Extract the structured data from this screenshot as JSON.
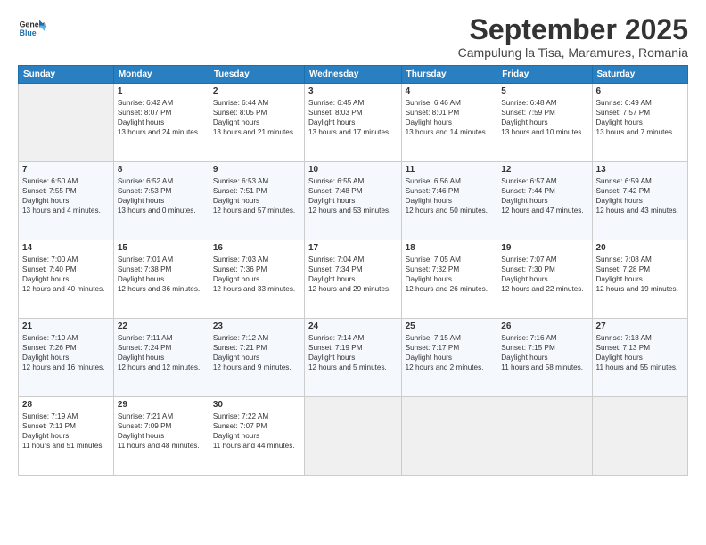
{
  "header": {
    "logo_top": "General",
    "logo_bottom": "Blue",
    "month": "September 2025",
    "location": "Campulung la Tisa, Maramures, Romania"
  },
  "days_of_week": [
    "Sunday",
    "Monday",
    "Tuesday",
    "Wednesday",
    "Thursday",
    "Friday",
    "Saturday"
  ],
  "weeks": [
    [
      {
        "day": null
      },
      {
        "day": 1,
        "sunrise": "6:42 AM",
        "sunset": "8:07 PM",
        "daylight": "13 hours and 24 minutes."
      },
      {
        "day": 2,
        "sunrise": "6:44 AM",
        "sunset": "8:05 PM",
        "daylight": "13 hours and 21 minutes."
      },
      {
        "day": 3,
        "sunrise": "6:45 AM",
        "sunset": "8:03 PM",
        "daylight": "13 hours and 17 minutes."
      },
      {
        "day": 4,
        "sunrise": "6:46 AM",
        "sunset": "8:01 PM",
        "daylight": "13 hours and 14 minutes."
      },
      {
        "day": 5,
        "sunrise": "6:48 AM",
        "sunset": "7:59 PM",
        "daylight": "13 hours and 10 minutes."
      },
      {
        "day": 6,
        "sunrise": "6:49 AM",
        "sunset": "7:57 PM",
        "daylight": "13 hours and 7 minutes."
      }
    ],
    [
      {
        "day": 7,
        "sunrise": "6:50 AM",
        "sunset": "7:55 PM",
        "daylight": "13 hours and 4 minutes."
      },
      {
        "day": 8,
        "sunrise": "6:52 AM",
        "sunset": "7:53 PM",
        "daylight": "13 hours and 0 minutes."
      },
      {
        "day": 9,
        "sunrise": "6:53 AM",
        "sunset": "7:51 PM",
        "daylight": "12 hours and 57 minutes."
      },
      {
        "day": 10,
        "sunrise": "6:55 AM",
        "sunset": "7:48 PM",
        "daylight": "12 hours and 53 minutes."
      },
      {
        "day": 11,
        "sunrise": "6:56 AM",
        "sunset": "7:46 PM",
        "daylight": "12 hours and 50 minutes."
      },
      {
        "day": 12,
        "sunrise": "6:57 AM",
        "sunset": "7:44 PM",
        "daylight": "12 hours and 47 minutes."
      },
      {
        "day": 13,
        "sunrise": "6:59 AM",
        "sunset": "7:42 PM",
        "daylight": "12 hours and 43 minutes."
      }
    ],
    [
      {
        "day": 14,
        "sunrise": "7:00 AM",
        "sunset": "7:40 PM",
        "daylight": "12 hours and 40 minutes."
      },
      {
        "day": 15,
        "sunrise": "7:01 AM",
        "sunset": "7:38 PM",
        "daylight": "12 hours and 36 minutes."
      },
      {
        "day": 16,
        "sunrise": "7:03 AM",
        "sunset": "7:36 PM",
        "daylight": "12 hours and 33 minutes."
      },
      {
        "day": 17,
        "sunrise": "7:04 AM",
        "sunset": "7:34 PM",
        "daylight": "12 hours and 29 minutes."
      },
      {
        "day": 18,
        "sunrise": "7:05 AM",
        "sunset": "7:32 PM",
        "daylight": "12 hours and 26 minutes."
      },
      {
        "day": 19,
        "sunrise": "7:07 AM",
        "sunset": "7:30 PM",
        "daylight": "12 hours and 22 minutes."
      },
      {
        "day": 20,
        "sunrise": "7:08 AM",
        "sunset": "7:28 PM",
        "daylight": "12 hours and 19 minutes."
      }
    ],
    [
      {
        "day": 21,
        "sunrise": "7:10 AM",
        "sunset": "7:26 PM",
        "daylight": "12 hours and 16 minutes."
      },
      {
        "day": 22,
        "sunrise": "7:11 AM",
        "sunset": "7:24 PM",
        "daylight": "12 hours and 12 minutes."
      },
      {
        "day": 23,
        "sunrise": "7:12 AM",
        "sunset": "7:21 PM",
        "daylight": "12 hours and 9 minutes."
      },
      {
        "day": 24,
        "sunrise": "7:14 AM",
        "sunset": "7:19 PM",
        "daylight": "12 hours and 5 minutes."
      },
      {
        "day": 25,
        "sunrise": "7:15 AM",
        "sunset": "7:17 PM",
        "daylight": "12 hours and 2 minutes."
      },
      {
        "day": 26,
        "sunrise": "7:16 AM",
        "sunset": "7:15 PM",
        "daylight": "11 hours and 58 minutes."
      },
      {
        "day": 27,
        "sunrise": "7:18 AM",
        "sunset": "7:13 PM",
        "daylight": "11 hours and 55 minutes."
      }
    ],
    [
      {
        "day": 28,
        "sunrise": "7:19 AM",
        "sunset": "7:11 PM",
        "daylight": "11 hours and 51 minutes."
      },
      {
        "day": 29,
        "sunrise": "7:21 AM",
        "sunset": "7:09 PM",
        "daylight": "11 hours and 48 minutes."
      },
      {
        "day": 30,
        "sunrise": "7:22 AM",
        "sunset": "7:07 PM",
        "daylight": "11 hours and 44 minutes."
      },
      {
        "day": null
      },
      {
        "day": null
      },
      {
        "day": null
      },
      {
        "day": null
      }
    ]
  ]
}
